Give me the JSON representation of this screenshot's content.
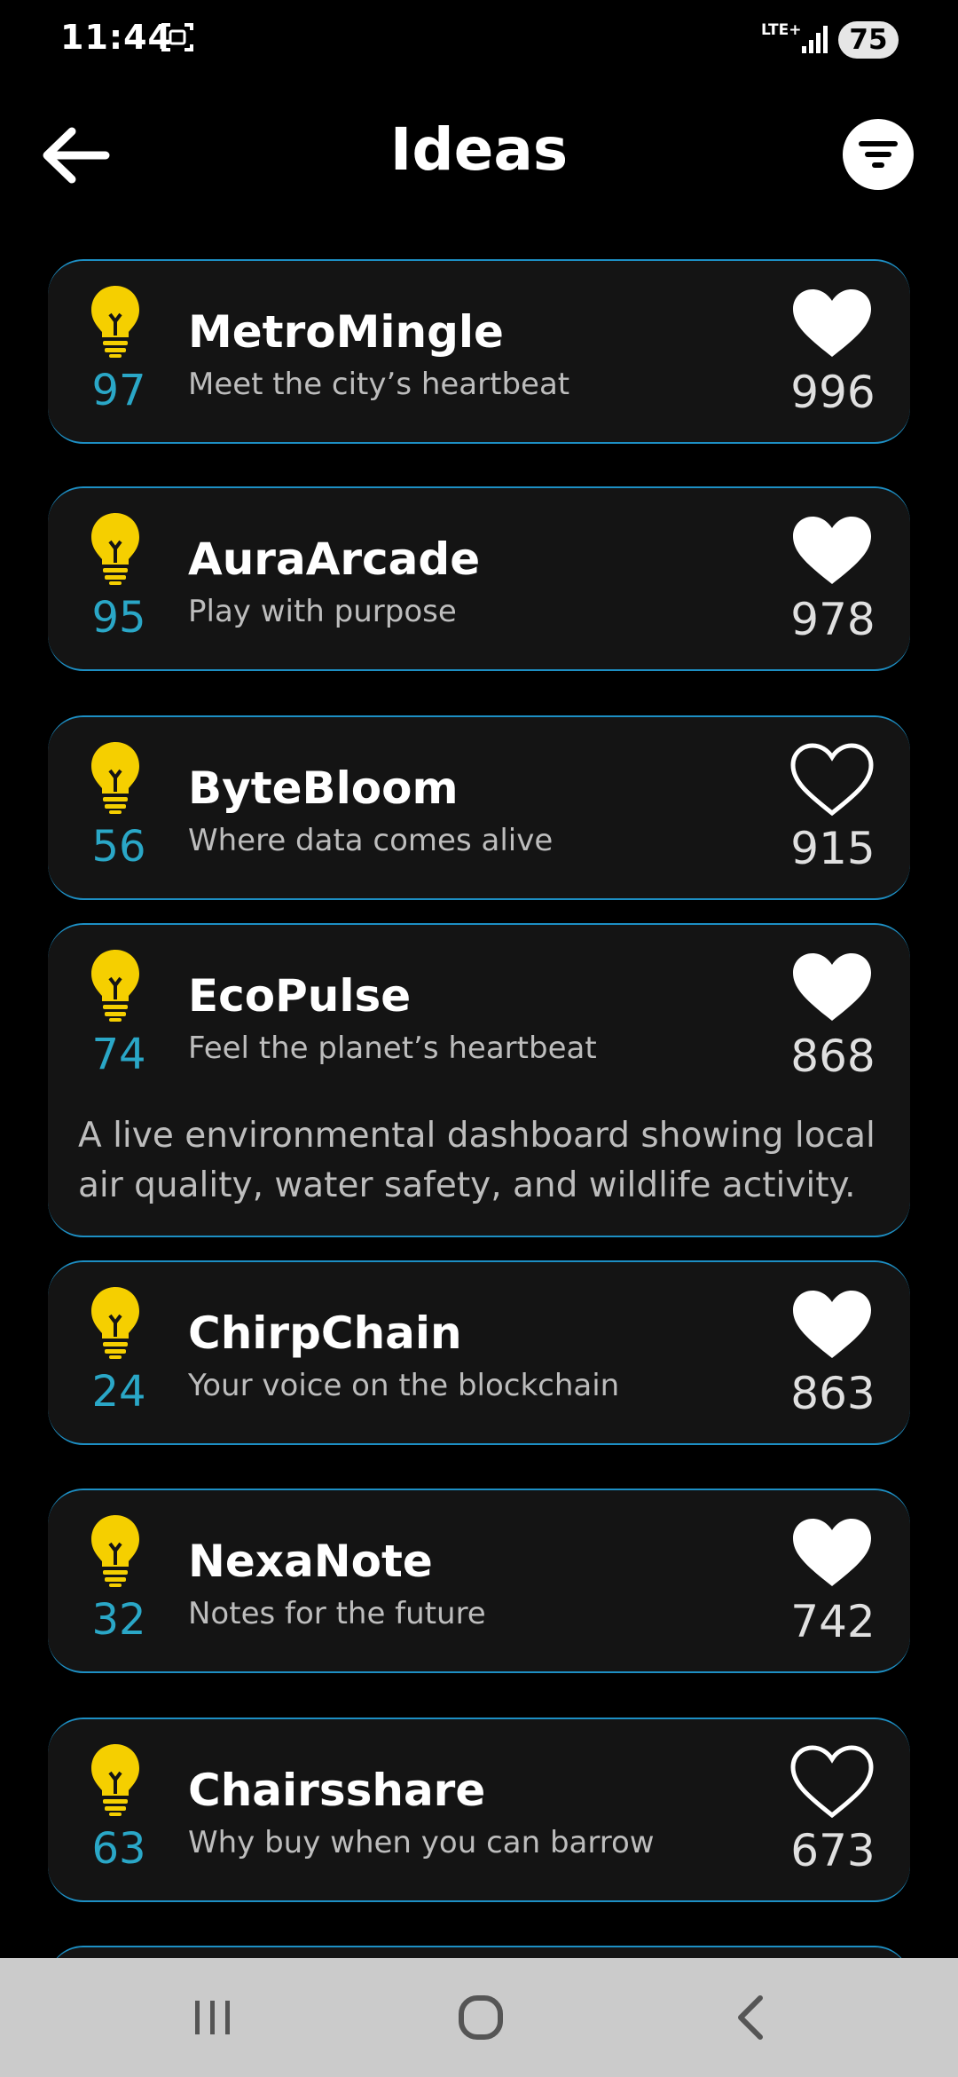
{
  "status_bar": {
    "time": "11:44",
    "network": "LTE+",
    "battery": "75"
  },
  "header": {
    "title": "Ideas"
  },
  "colors": {
    "accent": "#2aa7c7",
    "bulb": "#f5cf00",
    "card": "#141414",
    "border": "#1d8fc4"
  },
  "ideas": [
    {
      "title": "MetroMingle",
      "tagline": "Meet the city’s heartbeat",
      "score": "97",
      "likes": "996",
      "liked": true
    },
    {
      "title": "AuraArcade",
      "tagline": "Play with purpose",
      "score": "95",
      "likes": "978",
      "liked": true
    },
    {
      "title": "ByteBloom",
      "tagline": "Where data comes alive",
      "score": "56",
      "likes": "915",
      "liked": false
    },
    {
      "title": "EcoPulse",
      "tagline": "Feel the planet’s heartbeat",
      "score": "74",
      "likes": "868",
      "liked": true,
      "description": "A live environmental dashboard showing local air quality, water safety, and wildlife activity."
    },
    {
      "title": "ChirpChain",
      "tagline": "Your voice on the blockchain",
      "score": "24",
      "likes": "863",
      "liked": true
    },
    {
      "title": "NexaNote",
      "tagline": "Notes for the future",
      "score": "32",
      "likes": "742",
      "liked": true
    },
    {
      "title": "Chairsshare",
      "tagline": "Why buy when you can barrow",
      "score": "63",
      "likes": "673",
      "liked": false
    }
  ],
  "nav_bar": {
    "icons": [
      "recent-apps-icon",
      "home-icon",
      "back-icon"
    ]
  }
}
